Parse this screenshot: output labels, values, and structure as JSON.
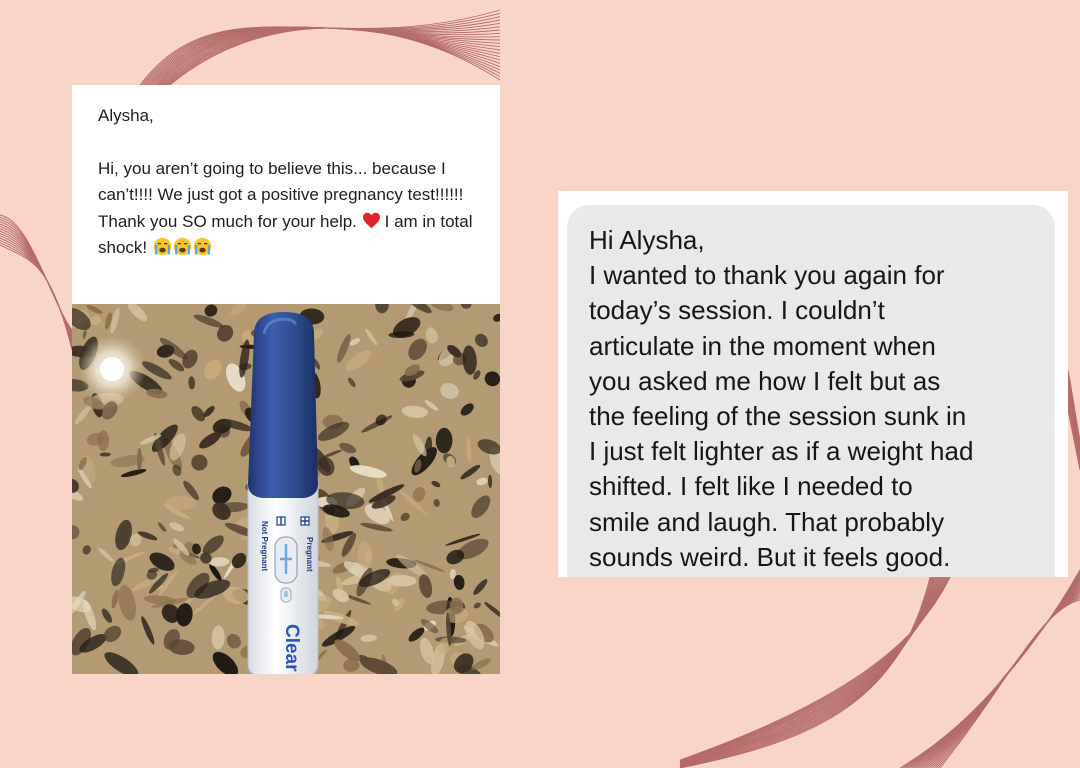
{
  "left_message": {
    "greeting": "Alysha,",
    "body": "Hi, you aren’t going to believe this... because I can’t!!!! We just got a positive pregnancy test!!!!!! Thank you SO much for your help.",
    "body_end": "I am in total shock!",
    "icons": [
      "heart-icon",
      "crying-face-icon",
      "crying-face-icon",
      "crying-face-icon"
    ]
  },
  "test_photo": {
    "label_pregnant": "Pregnant",
    "label_not_pregnant": "Not Pregnant",
    "brand": "Clear"
  },
  "right_message": {
    "lines": [
      "Hi Alysha,",
      "I wanted to thank you again for",
      "today’s session. I couldn’t",
      "articulate in the moment when",
      "you asked me how I felt but as",
      "the feeling of the session sunk in",
      "I just felt lighter as if a weight had",
      "shifted. I felt like I needed to",
      "smile and laugh. That probably",
      "sounds weird. But it feels good."
    ]
  },
  "colors": {
    "background": "#f9d5c8",
    "decorative_lines": "#a85a58",
    "bubble": "#e9e9ec",
    "test_cap": "#2c4a8c"
  }
}
